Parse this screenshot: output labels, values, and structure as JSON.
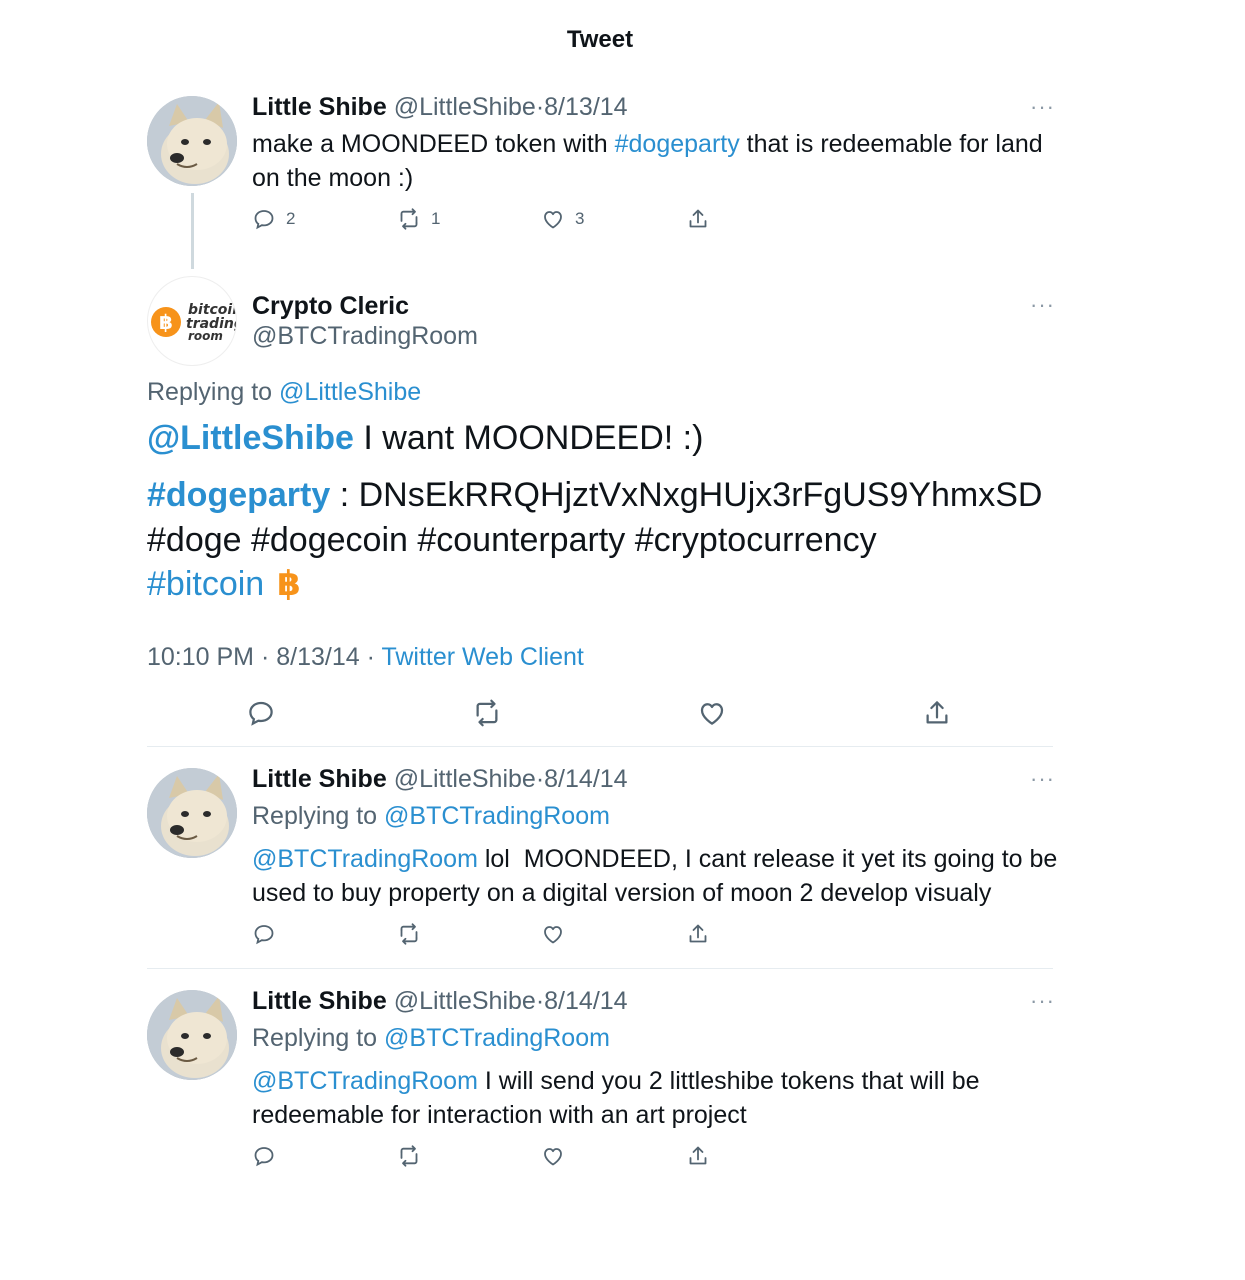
{
  "header": {
    "title": "Tweet"
  },
  "tweet1": {
    "name": "Little Shibe",
    "handle": "@LittleShibe",
    "sep": "·",
    "date": "8/13/14",
    "text_before": "make a MOONDEED token with ",
    "hashtag": "#dogeparty",
    "text_after": " that is redeemable for land on the moon :)",
    "replies": "2",
    "retweets": "1",
    "likes": "3",
    "more": "···"
  },
  "main": {
    "name": "Crypto Cleric",
    "handle": "@BTCTradingRoom",
    "avatar_text": [
      "bitcoin",
      "trading",
      "room"
    ],
    "replying_to_label": "Replying to",
    "replying_to_handle": "@LittleShibe",
    "line1_mention": "@LittleShibe",
    "line1_text": " I want MOONDEED! :)",
    "line2_hashtag": "#dogeparty",
    "line2_text": " : DNsEkRRQHjztVxNxgHUjx3rFgUS9YhmxSD",
    "line3": "#doge #dogecoin #counterparty #cryptocurrency",
    "line4": "#bitcoin",
    "time": "10:10 PM",
    "sep": "·",
    "date": "8/13/14",
    "client": "Twitter Web Client",
    "more": "···"
  },
  "reply1": {
    "name": "Little Shibe",
    "handle": "@LittleShibe",
    "sep": "·",
    "date": "8/14/14",
    "replying_to_label": "Replying to",
    "replying_to_handle": "@BTCTradingRoom",
    "mention": "@BTCTradingRoom",
    "text": " lol  MOONDEED, I cant release it yet its going to be used to buy property on a digital version of moon 2 develop visualy",
    "more": "···"
  },
  "reply2": {
    "name": "Little Shibe",
    "handle": "@LittleShibe",
    "sep": "·",
    "date": "8/14/14",
    "replying_to_label": "Replying to",
    "replying_to_handle": "@BTCTradingRoom",
    "mention": "@BTCTradingRoom",
    "text": " I will send you 2 littleshibe tokens that will be redeemable for interaction with an art project",
    "more": "···"
  },
  "colors": {
    "link": "#2a8fd0",
    "muted": "#536471",
    "bitcoin_orange": "#f7931a"
  },
  "icons": [
    "reply-icon",
    "retweet-icon",
    "like-icon",
    "share-icon",
    "more-icon",
    "bitcoin-emoji-icon"
  ]
}
